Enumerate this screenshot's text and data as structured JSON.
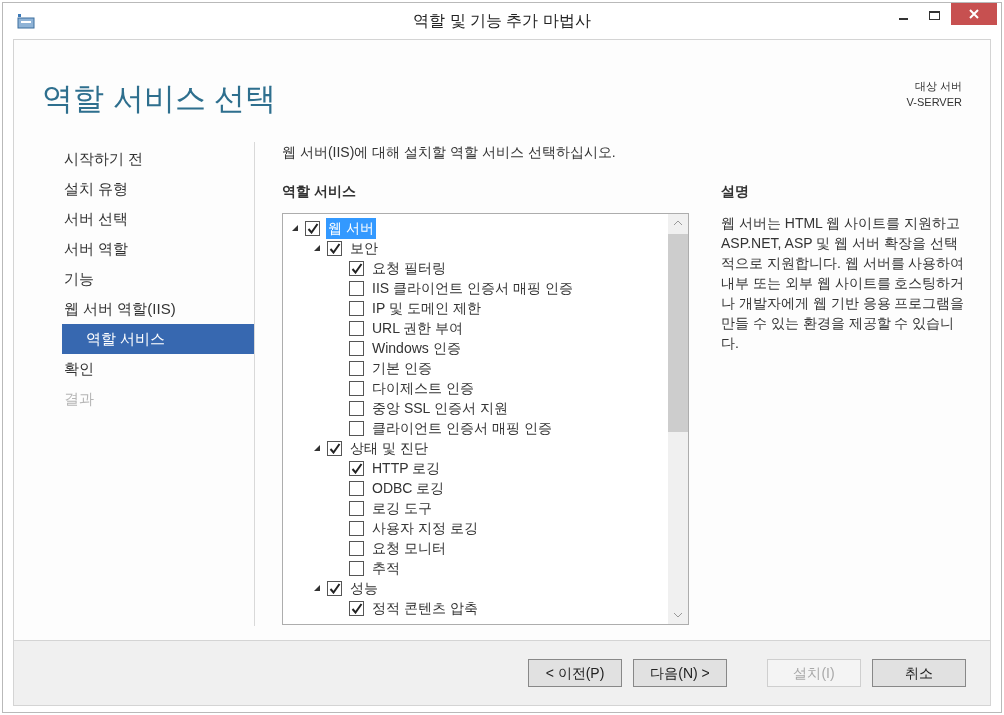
{
  "window": {
    "title": "역할 및 기능 추가 마법사"
  },
  "header": {
    "title": "역할 서비스 선택",
    "target_label": "대상 서버",
    "target_server": "V-SERVER"
  },
  "nav": [
    {
      "label": "시작하기 전",
      "selected": false,
      "disabled": false,
      "sub": false
    },
    {
      "label": "설치 유형",
      "selected": false,
      "disabled": false,
      "sub": false
    },
    {
      "label": "서버 선택",
      "selected": false,
      "disabled": false,
      "sub": false
    },
    {
      "label": "서버 역할",
      "selected": false,
      "disabled": false,
      "sub": false
    },
    {
      "label": "기능",
      "selected": false,
      "disabled": false,
      "sub": false
    },
    {
      "label": "웹 서버 역할(IIS)",
      "selected": false,
      "disabled": false,
      "sub": false
    },
    {
      "label": "역할 서비스",
      "selected": true,
      "disabled": false,
      "sub": true
    },
    {
      "label": "확인",
      "selected": false,
      "disabled": false,
      "sub": false
    },
    {
      "label": "결과",
      "selected": false,
      "disabled": true,
      "sub": false
    }
  ],
  "instruction": "웹 서버(IIS)에 대해 설치할 역할 서비스 선택하십시오.",
  "services": {
    "heading": "역할 서비스",
    "tree": [
      {
        "label": "웹 서버",
        "checked": true,
        "selected": true,
        "expanded": true,
        "children": [
          {
            "label": "보안",
            "checked": true,
            "selected": false,
            "expanded": true,
            "children": [
              {
                "label": "요청 필터링",
                "checked": true,
                "selected": false
              },
              {
                "label": "IIS 클라이언트 인증서 매핑 인증",
                "checked": false,
                "selected": false
              },
              {
                "label": "IP 및 도메인 제한",
                "checked": false,
                "selected": false
              },
              {
                "label": "URL 권한 부여",
                "checked": false,
                "selected": false
              },
              {
                "label": "Windows 인증",
                "checked": false,
                "selected": false
              },
              {
                "label": "기본 인증",
                "checked": false,
                "selected": false
              },
              {
                "label": "다이제스트 인증",
                "checked": false,
                "selected": false
              },
              {
                "label": "중앙 SSL 인증서 지원",
                "checked": false,
                "selected": false
              },
              {
                "label": "클라이언트 인증서 매핑 인증",
                "checked": false,
                "selected": false
              }
            ]
          },
          {
            "label": "상태 및 진단",
            "checked": true,
            "selected": false,
            "expanded": true,
            "children": [
              {
                "label": "HTTP 로깅",
                "checked": true,
                "selected": false
              },
              {
                "label": "ODBC 로깅",
                "checked": false,
                "selected": false
              },
              {
                "label": "로깅 도구",
                "checked": false,
                "selected": false
              },
              {
                "label": "사용자 지정 로깅",
                "checked": false,
                "selected": false
              },
              {
                "label": "요청 모니터",
                "checked": false,
                "selected": false
              },
              {
                "label": "추적",
                "checked": false,
                "selected": false
              }
            ]
          },
          {
            "label": "성능",
            "checked": true,
            "selected": false,
            "expanded": true,
            "children": [
              {
                "label": "정적 콘텐츠 압축",
                "checked": true,
                "selected": false
              }
            ]
          }
        ]
      }
    ]
  },
  "description": {
    "heading": "설명",
    "text": "웹 서버는 HTML 웹 사이트를 지원하고 ASP.NET, ASP 및 웹 서버 확장을 선택적으로 지원합니다. 웹 서버를 사용하여 내부 또는 외부 웹 사이트를 호스팅하거나 개발자에게 웹 기반 응용 프로그램을 만들 수 있는 환경을 제공할 수 있습니다."
  },
  "buttons": [
    {
      "label": "< 이전(P)",
      "disabled": false
    },
    {
      "label": "다음(N) >",
      "disabled": false
    },
    {
      "label": "설치(I)",
      "disabled": true
    },
    {
      "label": "취소",
      "disabled": false
    }
  ]
}
